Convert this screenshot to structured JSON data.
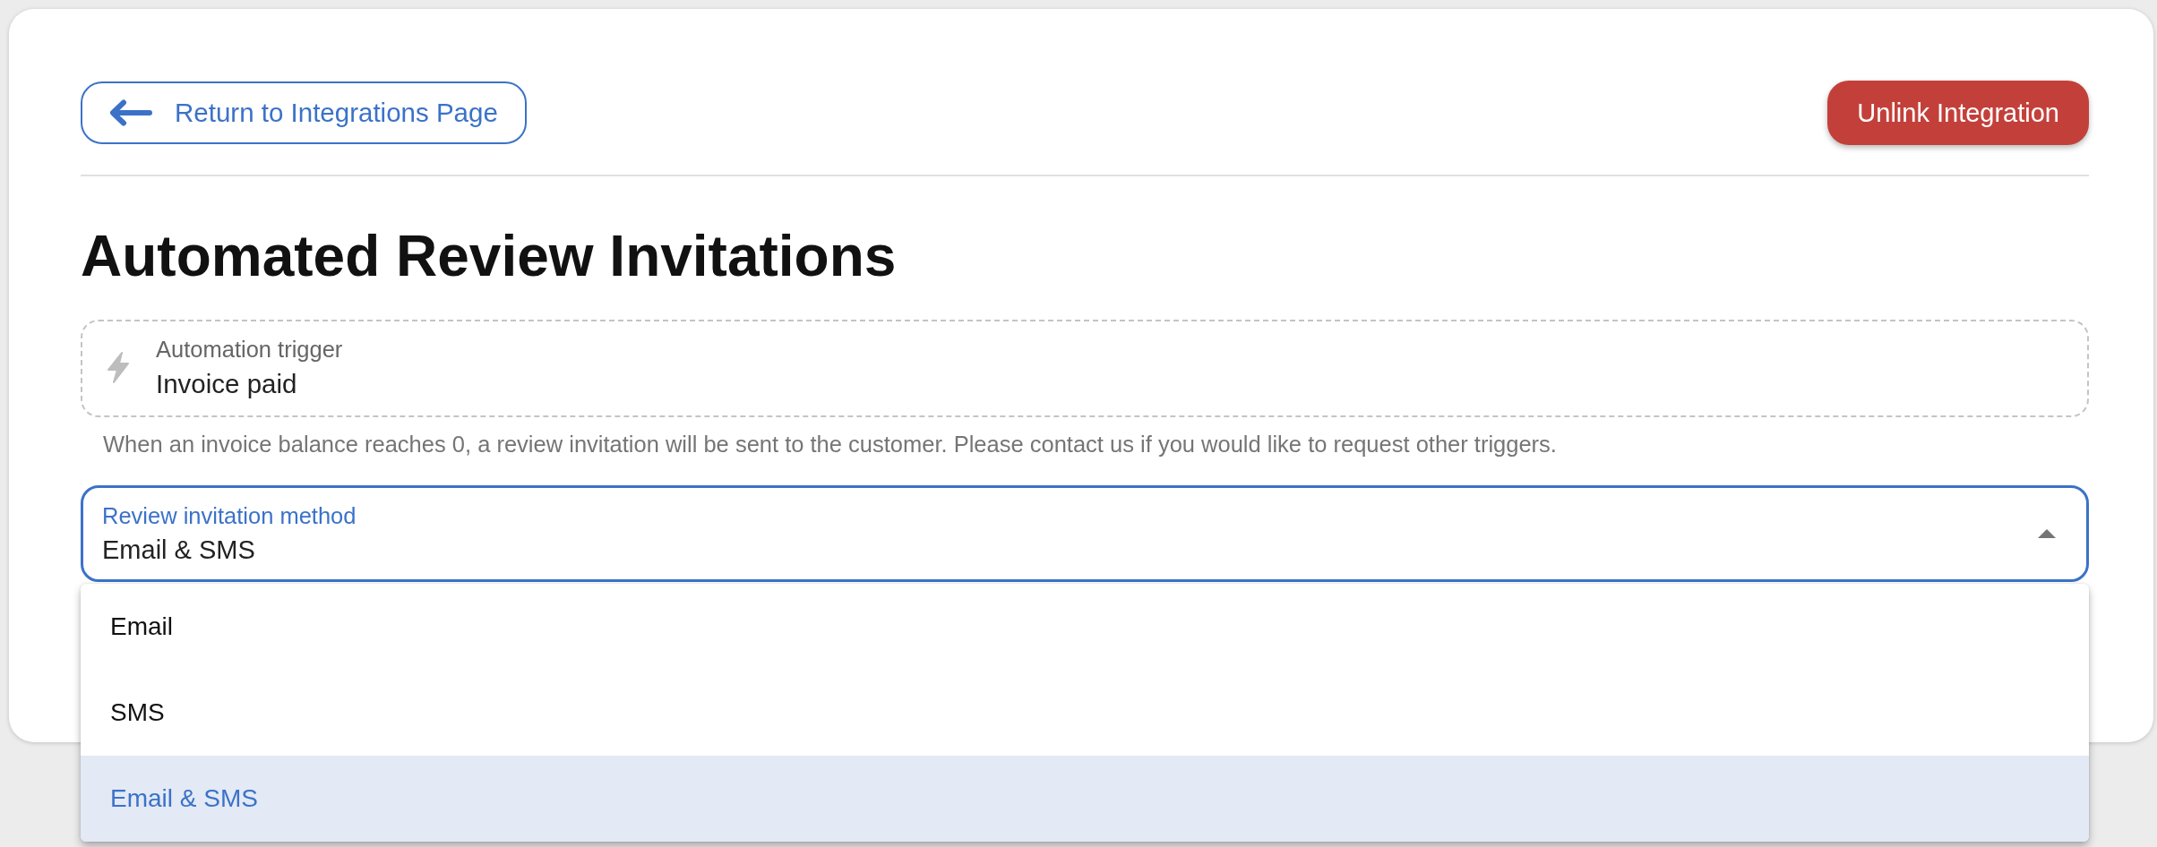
{
  "header": {
    "back_button": "Return to Integrations Page",
    "unlink_button": "Unlink Integration"
  },
  "title": "Automated Review Invitations",
  "trigger_field": {
    "label": "Automation trigger",
    "value": "Invoice paid",
    "disabled": true
  },
  "helper_text": "When an invoice balance reaches 0, a review invitation will be sent to the customer. Please contact us if you would like to request other triggers.",
  "method_select": {
    "label": "Review invitation method",
    "value": "Email & SMS",
    "focused": true,
    "expanded": true,
    "options": [
      {
        "label": "Email",
        "selected": false
      },
      {
        "label": "SMS",
        "selected": false
      },
      {
        "label": "Email & SMS",
        "selected": true
      }
    ]
  }
}
